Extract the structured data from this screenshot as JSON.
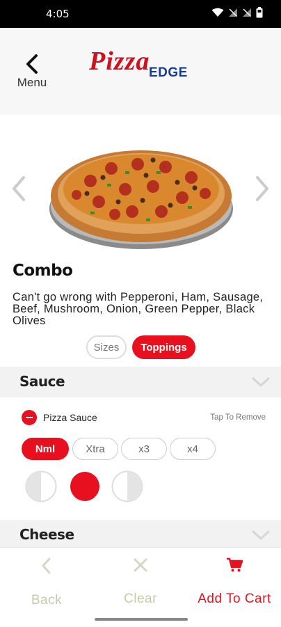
{
  "status_bar": {
    "time": "4:05"
  },
  "header": {
    "menu_label": "Menu",
    "logo_pizza": "Pizza",
    "logo_edge": "EDGE"
  },
  "product": {
    "name": "Combo",
    "description": "Can't go wrong with Pepperoni, Ham, Sausage, Beef, Mushroom, Onion, Green Pepper, Black Olives"
  },
  "tabs": {
    "sizes": "Sizes",
    "toppings": "Toppings",
    "selected": "Toppings"
  },
  "sections": {
    "sauce": {
      "title": "Sauce",
      "topping": "Pizza Sauce",
      "tap_to_remove": "Tap To Remove",
      "amounts": [
        "Nml",
        "Xtra",
        "x3",
        "x4"
      ],
      "selected_amount": "Nml",
      "portions": [
        "left-half",
        "whole",
        "right-half"
      ],
      "selected_portion": "whole"
    },
    "cheese": {
      "title": "Cheese"
    }
  },
  "bottom_bar": {
    "back": "Back",
    "clear": "Clear",
    "add_to_cart": "Add To Cart"
  },
  "colors": {
    "accent": "#e8101e",
    "logo_blue": "#1a3a9a",
    "muted": "#c9c9a8"
  }
}
